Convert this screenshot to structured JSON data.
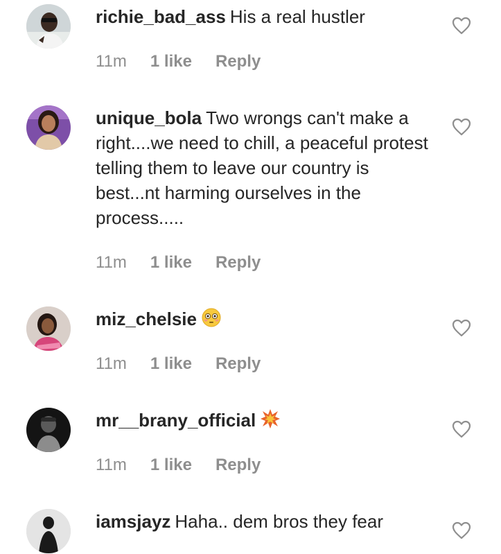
{
  "comments": [
    {
      "username": "richie_bad_ass",
      "text": "His a real hustler",
      "time": "11m",
      "likes": "1 like",
      "reply": "Reply",
      "emoji": "",
      "avatar_icon": "avatar-photo-icon"
    },
    {
      "username": "unique_bola",
      "text": "Two wrongs can't make a right....we need to chill, a peaceful protest telling them to leave our country is best...nt harming ourselves in the process.....",
      "time": "11m",
      "likes": "1 like",
      "reply": "Reply",
      "emoji": "",
      "avatar_icon": "avatar-photo-icon"
    },
    {
      "username": "miz_chelsie",
      "text": "",
      "time": "11m",
      "likes": "1 like",
      "reply": "Reply",
      "emoji": "flushed-face-emoji",
      "avatar_icon": "avatar-photo-icon"
    },
    {
      "username": "mr__brany_official",
      "text": "",
      "time": "11m",
      "likes": "1 like",
      "reply": "Reply",
      "emoji": "collision-emoji",
      "avatar_icon": "avatar-photo-icon"
    },
    {
      "username": "iamsjayz",
      "text": "Haha.. dem bros they fear",
      "time": "",
      "likes": "",
      "reply": "",
      "emoji": "",
      "avatar_icon": "avatar-photo-icon"
    }
  ],
  "icons": {
    "like": "heart-outline-icon"
  },
  "colors": {
    "text": "#262626",
    "meta": "#8e8e8e",
    "heart_stroke": "#8e8e8e"
  }
}
